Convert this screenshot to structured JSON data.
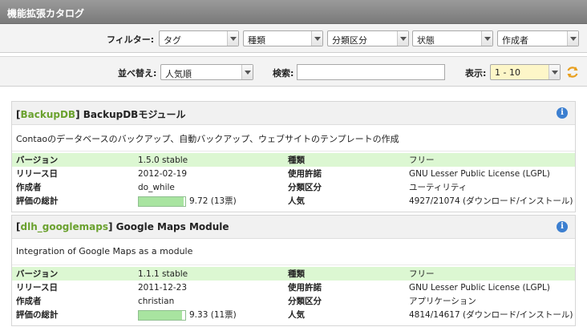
{
  "window": {
    "title": "機能拡張カタログ"
  },
  "filters": {
    "label": "フィルター:",
    "tag": "タグ",
    "type": "種類",
    "category": "分類区分",
    "status": "状態",
    "author": "作成者"
  },
  "sortbar": {
    "sort_label": "並べ替え:",
    "sort_value": "人気順",
    "search_label": "検索:",
    "search_value": "",
    "display_label": "表示:",
    "display_value": "1 - 10"
  },
  "extensions": [
    {
      "key": "BackupDB",
      "name": "BackupDBモジュール",
      "description": "Contaoのデータベースのバックアップ、自動バックアップ、ウェブサイトのテンプレートの作成",
      "version_label": "バージョン",
      "version": "1.5.0 stable",
      "type_label": "種類",
      "type": "フリー",
      "release_label": "リリース日",
      "release": "2012-02-19",
      "license_label": "使用許諾",
      "license": "GNU Lesser Public License (LGPL)",
      "author_label": "作成者",
      "author": "do_while",
      "category_label": "分類区分",
      "category": "ユーティリティ",
      "rating_label": "評価の総計",
      "rating": "9.72 (13票)",
      "rating_fraction": 0.972,
      "popularity_label": "人気",
      "popularity": "4927/21074 (ダウンロード/インストール)"
    },
    {
      "key": "dlh_googlemaps",
      "name": "Google Maps Module",
      "description": "Integration of Google Maps as a module",
      "version_label": "バージョン",
      "version": "1.1.1 stable",
      "type_label": "種類",
      "type": "フリー",
      "release_label": "リリース日",
      "release": "2011-12-23",
      "license_label": "使用許諾",
      "license": "GNU Lesser Public License (LGPL)",
      "author_label": "作成者",
      "author": "christian",
      "category_label": "分類区分",
      "category": "アプリケーション",
      "rating_label": "評価の総計",
      "rating": "9.33 (11票)",
      "rating_fraction": 0.933,
      "popularity_label": "人気",
      "popularity": "4814/14617 (ダウンロード/インストール)"
    }
  ]
}
